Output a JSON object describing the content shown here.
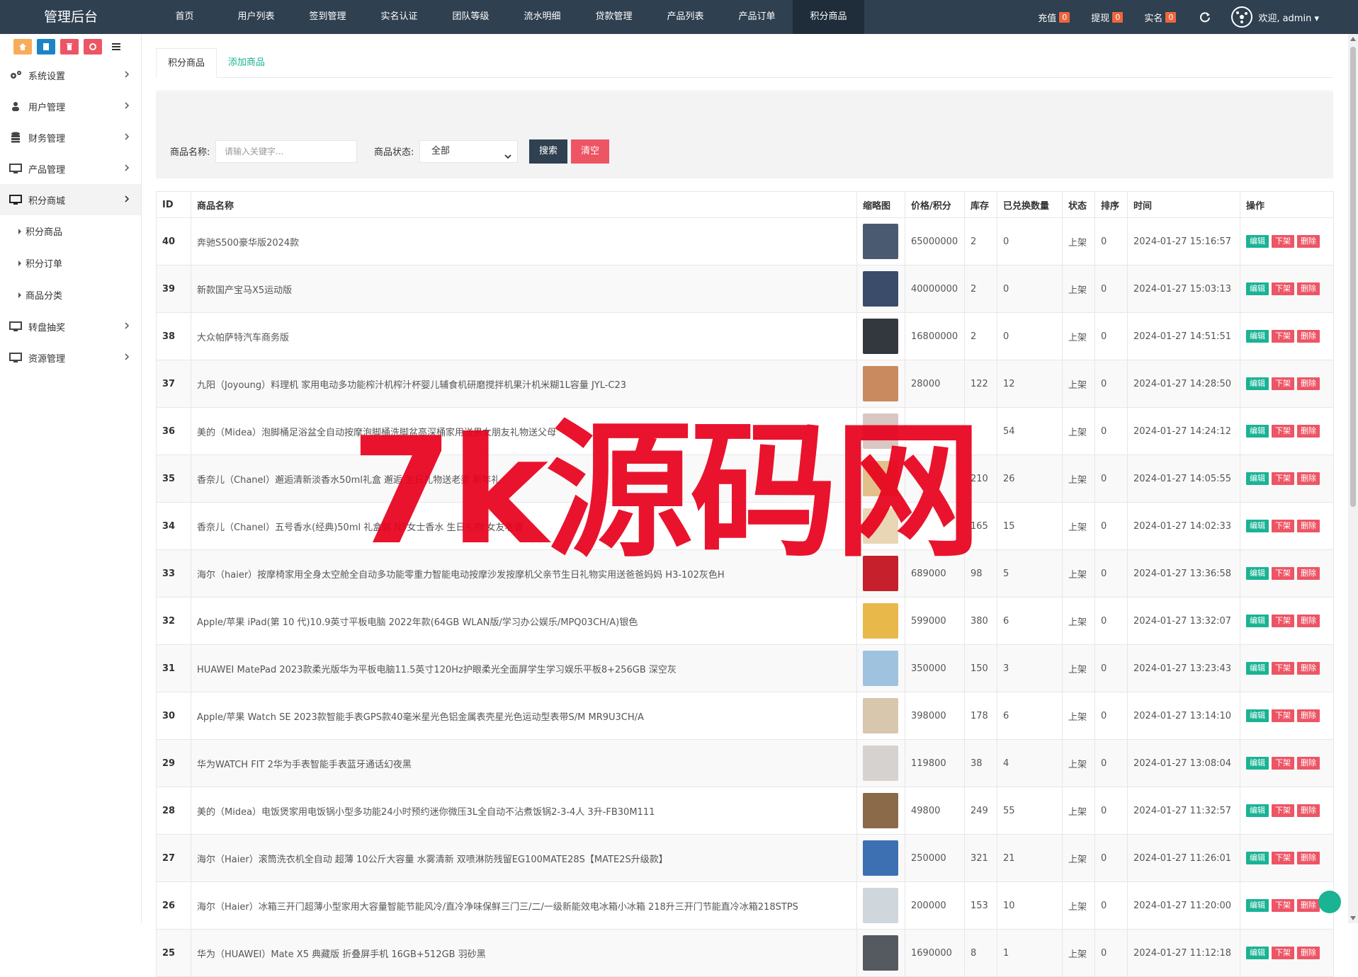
{
  "brand": "管理后台",
  "top_nav": [
    "首页",
    "用户列表",
    "签到管理",
    "实名认证",
    "团队等级",
    "流水明细",
    "贷款管理",
    "产品列表",
    "产品订单",
    "积分商品"
  ],
  "top_stats": [
    {
      "label": "充值",
      "count": "0"
    },
    {
      "label": "提现",
      "count": "0"
    },
    {
      "label": "实名",
      "count": "0"
    }
  ],
  "welcome": "欢迎, admin",
  "colors": {
    "topbar": "#2f4050",
    "accent_green": "#1ab394",
    "accent_red": "#ed5565"
  },
  "sidebar": {
    "menu": [
      {
        "label": "系统设置",
        "icon": "gears-icon"
      },
      {
        "label": "用户管理",
        "icon": "user-icon"
      },
      {
        "label": "财务管理",
        "icon": "database-icon"
      },
      {
        "label": "产品管理",
        "icon": "monitor-icon"
      },
      {
        "label": "积分商城",
        "icon": "monitor-icon"
      }
    ],
    "submenu": [
      "积分商品",
      "积分订单",
      "商品分类"
    ],
    "menu_bottom": [
      {
        "label": "转盘抽奖",
        "icon": "monitor-icon"
      },
      {
        "label": "资源管理",
        "icon": "monitor-icon"
      }
    ]
  },
  "tabs": [
    "积分商品",
    "添加商品"
  ],
  "filter": {
    "name_label": "商品名称:",
    "name_placeholder": "请输入关键字...",
    "status_label": "商品状态:",
    "status_value": "全部",
    "search_btn": "搜索",
    "clear_btn": "清空"
  },
  "table": {
    "headers": [
      "ID",
      "商品名称",
      "缩略图",
      "价格/积分",
      "库存",
      "已兑换数量",
      "状态",
      "排序",
      "时间",
      "操作"
    ],
    "actions": [
      "编辑",
      "下架",
      "删除"
    ],
    "rows": [
      {
        "id": "40",
        "name": "奔驰S500豪华版2024款",
        "price": "65000000",
        "stock": "2",
        "sold": "0",
        "status": "上架",
        "sort": "0",
        "time": "2024-01-27 15:16:57",
        "thumb_color": "#4a5a70"
      },
      {
        "id": "39",
        "name": "新款国产宝马X5运动版",
        "price": "40000000",
        "stock": "2",
        "sold": "0",
        "status": "上架",
        "sort": "0",
        "time": "2024-01-27 15:03:13",
        "thumb_color": "#3a4c6a"
      },
      {
        "id": "38",
        "name": "大众帕萨特汽车商务版",
        "price": "16800000",
        "stock": "2",
        "sold": "0",
        "status": "上架",
        "sort": "0",
        "time": "2024-01-27 14:51:51",
        "thumb_color": "#33373e"
      },
      {
        "id": "37",
        "name": "九阳（Joyoung）料理机 家用电动多功能榨汁机榨汁杯婴儿辅食机研磨搅拌机果汁机米糊1L容量 JYL-C23",
        "price": "28000",
        "stock": "122",
        "sold": "12",
        "status": "上架",
        "sort": "0",
        "time": "2024-01-27 14:28:50",
        "thumb_color": "#c98a60"
      },
      {
        "id": "36",
        "name": "美的（Midea）泡脚桶足浴盆全自动按摩泡脚桶洗脚盆高深桶家用送男女朋友礼物送父母",
        "price": "",
        "stock": "",
        "sold": "54",
        "status": "上架",
        "sort": "0",
        "time": "2024-01-27 14:24:12",
        "thumb_color": "#d9c7c4"
      },
      {
        "id": "35",
        "name": "香奈儿（Chanel）邂逅清新淡香水50ml礼盒 邂逅 生日礼物送老婆 新年礼",
        "price": "",
        "stock": "210",
        "sold": "26",
        "status": "上架",
        "sort": "0",
        "time": "2024-01-27 14:05:55",
        "thumb_color": "#e3c08a"
      },
      {
        "id": "34",
        "name": "香奈儿（Chanel）五号香水(经典)50ml 礼盒装 N5女士香水 生日礼物 女友老婆",
        "price": "",
        "stock": "165",
        "sold": "15",
        "status": "上架",
        "sort": "0",
        "time": "2024-01-27 14:02:33",
        "thumb_color": "#e8d6b5"
      },
      {
        "id": "33",
        "name": "海尔（haier）按摩椅家用全身太空舱全自动多功能零重力智能电动按摩沙发按摩机父亲节生日礼物实用送爸爸妈妈 H3-102灰色H",
        "price": "689000",
        "stock": "98",
        "sold": "5",
        "status": "上架",
        "sort": "0",
        "time": "2024-01-27 13:36:58",
        "thumb_color": "#c5202b"
      },
      {
        "id": "32",
        "name": "Apple/苹果 iPad(第 10 代)10.9英寸平板电脑 2022年款(64GB WLAN版/学习办公娱乐/MPQ03CH/A)银色",
        "price": "599000",
        "stock": "380",
        "sold": "6",
        "status": "上架",
        "sort": "0",
        "time": "2024-01-27 13:32:07",
        "thumb_color": "#e9b84a"
      },
      {
        "id": "31",
        "name": "HUAWEI MatePad 2023款柔光版华为平板电脑11.5英寸120Hz护眼柔光全面屏学生学习娱乐平板8+256GB 深空灰",
        "price": "350000",
        "stock": "150",
        "sold": "3",
        "status": "上架",
        "sort": "0",
        "time": "2024-01-27 13:23:43",
        "thumb_color": "#9fc2de"
      },
      {
        "id": "30",
        "name": "Apple/苹果 Watch SE 2023款智能手表GPS款40毫米星光色铝金属表壳星光色运动型表带S/M MR9U3CH/A",
        "price": "398000",
        "stock": "178",
        "sold": "6",
        "status": "上架",
        "sort": "0",
        "time": "2024-01-27 13:14:10",
        "thumb_color": "#d8c6ad"
      },
      {
        "id": "29",
        "name": "华为WATCH FIT 2华为手表智能手表蓝牙通话幻夜黑",
        "price": "119800",
        "stock": "38",
        "sold": "4",
        "status": "上架",
        "sort": "0",
        "time": "2024-01-27 13:08:04",
        "thumb_color": "#d6d2cf"
      },
      {
        "id": "28",
        "name": "美的（Midea）电饭煲家用电饭锅小型多功能24小时预约迷你微压3L全自动不沾煮饭锅2-3-4人 3升-FB30M111",
        "price": "49800",
        "stock": "249",
        "sold": "55",
        "status": "上架",
        "sort": "0",
        "time": "2024-01-27 11:32:57",
        "thumb_color": "#8b6a4a"
      },
      {
        "id": "27",
        "name": "海尔（Haier）滚筒洗衣机全自动 超薄 10公斤大容量 水雾清新 双喷淋防残留EG100MATE28S【MATE2S升级款】",
        "price": "250000",
        "stock": "321",
        "sold": "21",
        "status": "上架",
        "sort": "0",
        "time": "2024-01-27 11:26:01",
        "thumb_color": "#3d6fb3"
      },
      {
        "id": "26",
        "name": "海尔（Haier）冰箱三开门超薄小型家用大容量智能节能风冷/直冷净味保鲜三门三/二/一级新能效电冰箱小冰箱 218升三开门节能直冷冰箱218STPS",
        "price": "200000",
        "stock": "153",
        "sold": "10",
        "status": "上架",
        "sort": "0",
        "time": "2024-01-27 11:20:00",
        "thumb_color": "#cfd6dc"
      },
      {
        "id": "25",
        "name": "华为（HUAWEI）Mate X5 典藏版 折叠屏手机 16GB+512GB 羽砂黑",
        "price": "1690000",
        "stock": "8",
        "sold": "1",
        "status": "上架",
        "sort": "0",
        "time": "2024-01-27 11:12:18",
        "thumb_color": "#555a60"
      }
    ]
  },
  "watermark": "7k源码网"
}
